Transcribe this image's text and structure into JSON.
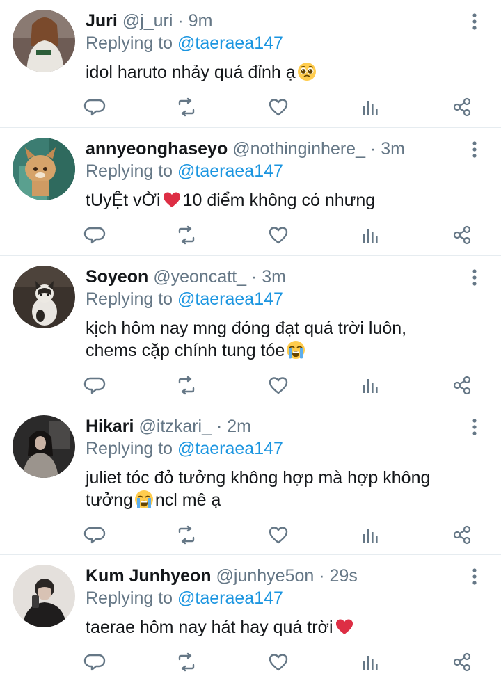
{
  "replying_label": "Replying to",
  "replying_to": "@taeraea147",
  "colors": {
    "text": "#14171a",
    "muted": "#657786",
    "link": "#1b95e0",
    "divider": "#e6ecf0"
  },
  "tweets": [
    {
      "name": "Juri",
      "handle": "@j_uri",
      "time": "9m",
      "lines": [
        {
          "a": "idol haruto nhảy quá đỉnh ạ",
          "emoji": "pleading-face-icon",
          "b": ""
        }
      ]
    },
    {
      "name": "annyeonghaseyo",
      "handle": "@nothinginhere_",
      "time": "3m",
      "lines": [
        {
          "a": "tUyỆt vỜi",
          "emoji": "red-heart-icon",
          "b": "10 điểm không có nhưng"
        }
      ]
    },
    {
      "name": "Soyeon",
      "handle": "@yeoncatt_",
      "time": "3m",
      "lines": [
        {
          "a": "kịch hôm nay mng đóng đạt quá trời luôn,",
          "emoji": "",
          "b": ""
        },
        {
          "a": "chems cặp chính tung tóe",
          "emoji": "crying-face-icon",
          "b": ""
        }
      ]
    },
    {
      "name": "Hikari",
      "handle": "@itzkari_",
      "time": "2m",
      "lines": [
        {
          "a": "juliet tóc đỏ tưởng không hợp mà hợp không",
          "emoji": "",
          "b": ""
        },
        {
          "a": "tưởng",
          "emoji": "crying-face-icon",
          "b": "ncl mê ạ"
        }
      ]
    },
    {
      "name": "Kum Junhyeon",
      "handle": "@junhye5on",
      "time": "29s",
      "lines": [
        {
          "a": "taerae hôm nay hát hay quá trời",
          "emoji": "red-heart-icon",
          "b": ""
        }
      ]
    }
  ]
}
